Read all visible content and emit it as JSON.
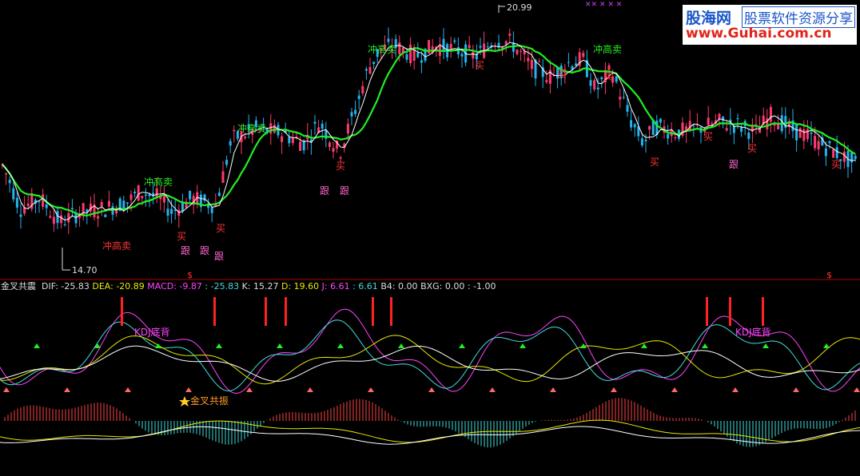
{
  "chart_data": [
    {
      "type": "candlestick",
      "title": "",
      "price_labels": {
        "high": "20.99",
        "low": "14.70"
      },
      "ylim": [
        14.0,
        21.5
      ],
      "markers": [
        "冲高卖",
        "冲高卖",
        "冲高卖",
        "冲高卖",
        "冲高卖",
        "买",
        "买",
        "买",
        "买",
        "买",
        "买",
        "买",
        "买",
        "买",
        "买",
        "跟",
        "跟",
        "跟",
        "跟",
        "跟",
        "跟"
      ],
      "bottom_flags": [
        "$",
        "$"
      ],
      "series": [
        {
          "name": "MA",
          "color": "#22ee22"
        },
        {
          "name": "close",
          "color": "#ffffff"
        }
      ]
    },
    {
      "type": "line",
      "indicator_name": "金叉共震",
      "readouts": [
        {
          "label": "DIF:",
          "value": "-25.83",
          "color": "#dddddd"
        },
        {
          "label": "DEA:",
          "value": "-20.89",
          "color": "#e8e800"
        },
        {
          "label": "MACD:",
          "value": "-9.87",
          "color": "#ff44ff"
        },
        {
          "label": ":",
          "value": "-25.83",
          "color": "#44dddd"
        },
        {
          "label": "K:",
          "value": "15.27",
          "color": "#dddddd"
        },
        {
          "label": "D:",
          "value": "19.60",
          "color": "#e8e800"
        },
        {
          "label": "J:",
          "value": "6.61",
          "color": "#ff44ff"
        },
        {
          "label": ":",
          "value": "6.61",
          "color": "#44dddd"
        },
        {
          "label": "B4:",
          "value": "0.00",
          "color": "#dddddd"
        },
        {
          "label": "BXG:",
          "value": "0.00",
          "color": "#dddddd"
        },
        {
          "label": ":",
          "value": "-1.00",
          "color": "#dddddd"
        }
      ],
      "annotations": [
        "KDJ底背",
        "KDJ底背",
        "金叉共振"
      ]
    }
  ],
  "logo": {
    "name": "股海网",
    "tagline": "股票软件资源分享",
    "url": "www.Guhai.com.cn"
  },
  "top_marks": "✕✕   ✕    ✕   ✕",
  "colors": {
    "up": "#ff3a6e",
    "down": "#22b4ee",
    "ma": "#22ee22",
    "separator": "#b00000"
  }
}
